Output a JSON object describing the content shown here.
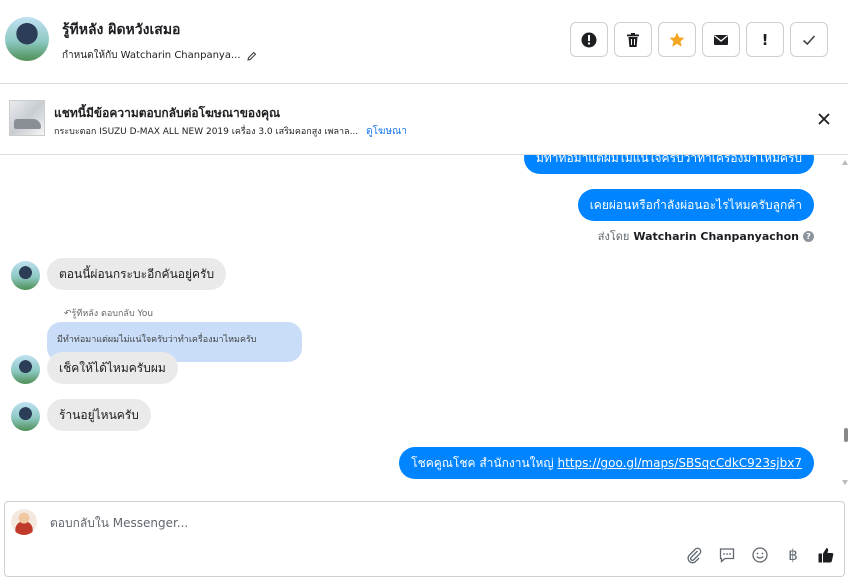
{
  "header": {
    "contact_name": "รู้ทีหลัง ผิดหวังเสมอ",
    "assigned_to": "กำหนดให้กับ Watcharin Chanpanya...",
    "actions": [
      {
        "name": "spam-icon"
      },
      {
        "name": "trash-icon"
      },
      {
        "name": "star-icon",
        "color": "#f5a623"
      },
      {
        "name": "envelope-icon"
      },
      {
        "name": "follow-up-icon",
        "label": "!"
      },
      {
        "name": "check-icon"
      }
    ]
  },
  "ad_context": {
    "title": "แชทนี้มีข้อความตอบกลับต่อโฆษณาของคุณ",
    "subtitle": "กระบะตอก ISUZU D-MAX ALL NEW 2019 เครื่อง 3.0 เสริมคอกสูง เพลาล...",
    "link": "ดูโฆษณา"
  },
  "messages": {
    "out_1": "มีทำท่อมาแต่ผมไม่แน่ใจครับว่าทำเครื่องมาไหมครับ",
    "out_2": "เคยผ่อนหรือกำลังผ่อนอะไรไหมครับลูกค้า",
    "sent_by_prefix": "ส่งโดย",
    "sent_by_name": "Watcharin Chanpanyachon",
    "in_1": "ตอนนี้ผ่อนกระบะอีกคันอยู่ครับ",
    "reply_meta": "รู้ทีหลัง ตอบกลับ You",
    "quoted": "มีทำท่อมาแต่ผมไม่แน่ใจครับว่าทำเครื่องมาไหมครับ",
    "in_2": "เช็คให้ได้ไหมครับผม",
    "in_3": "ร้านอยู่ไหนครับ",
    "out_3_text": "โชคคูณโชค สำนักงานใหญ่ ",
    "out_3_link": "https://goo.gl/maps/SBSqcCdkC923sjbx7"
  },
  "composer": {
    "placeholder": "ตอบกลับใน Messenger...",
    "tools": [
      "paperclip-icon",
      "saved-reply-icon",
      "emoji-icon",
      "baht-icon",
      "thumbs-up-icon"
    ],
    "baht_symbol": "฿",
    "brand_color": "#1877f2"
  }
}
